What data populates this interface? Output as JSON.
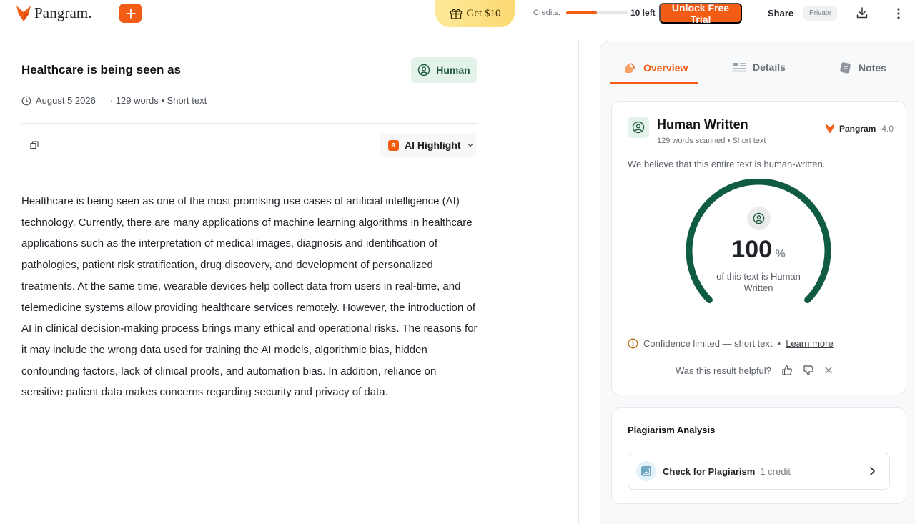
{
  "header": {
    "logo_text": "Pangram.",
    "get_label": "Get $10",
    "credits_label": "Credits:",
    "credits_fraction": 0.5,
    "credits_left": "10 left",
    "trial_label": "Unlock Free Trial",
    "share_label": "Share",
    "private_label": "Private"
  },
  "document": {
    "title": "Healthcare is being seen as",
    "result_badge": "Human",
    "date": "August 5 2026",
    "meta": "· 129 words • Short text",
    "highlight_label": "AI Highlight",
    "highlight_badge": "a",
    "body": "Healthcare is being seen as one of the most promising use cases of artificial intelligence (AI) technology. Currently, there are many applications of machine learning algorithms in healthcare applications such as the interpretation of medical images, diagnosis and identification of pathologies, patient risk stratification, drug discovery, and development of personalized treatments. At the same time, wearable devices help collect data from users in real-time, and telemedicine systems allow providing healthcare services remotely. However, the introduction of AI in clinical decision-making process brings many ethical and operational risks. The reasons for it may include the wrong data used for training the AI models, algorithmic bias, hidden confounding factors, lack of clinical proofs, and automation bias. In addition, reliance on sensitive patient data makes concerns regarding security and privacy of data."
  },
  "panel": {
    "tabs": [
      {
        "label": "Overview",
        "active": true,
        "icon": "overview-icon"
      },
      {
        "label": "Details",
        "active": false,
        "icon": "details-icon"
      },
      {
        "label": "Notes",
        "active": false,
        "icon": "notes-icon"
      }
    ],
    "result": {
      "title": "Human Written",
      "subtitle": "129 words scanned • Short text",
      "brand": "Pangram",
      "version": "4.0",
      "belief": "We believe that this entire text is human-written.",
      "percent": "100",
      "percent_sign": "%",
      "percent_label": "of this text is Human Written",
      "confidence": "Confidence limited — short text",
      "learn_more": "Learn more",
      "helpful_question": "Was this result helpful?"
    },
    "plagiarism": {
      "title": "Plagiarism Analysis",
      "button_label": "Check for Plagiarism",
      "cost": "1 credit"
    }
  },
  "colors": {
    "accent": "#f25c14",
    "human_green": "#0f5c43",
    "human_bg": "#e3f3ea"
  }
}
